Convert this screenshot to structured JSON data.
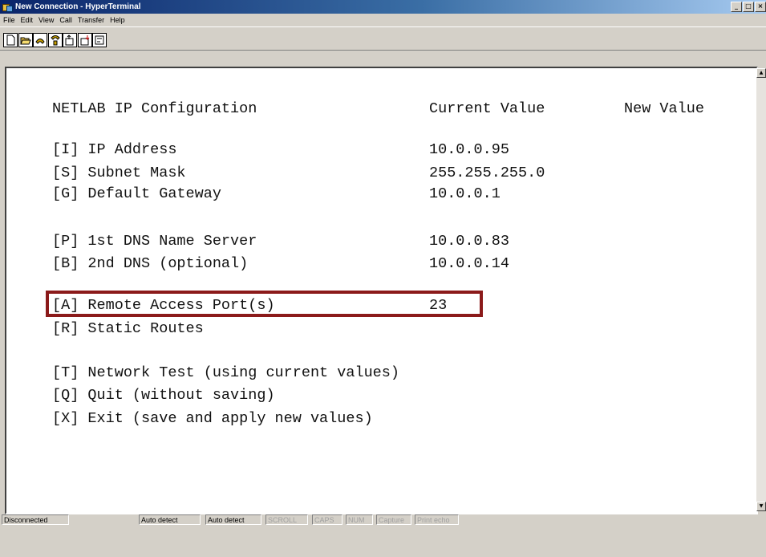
{
  "window": {
    "title": "New Connection - HyperTerminal",
    "buttons": {
      "minimize": "_",
      "maximize": "□",
      "close": "×"
    }
  },
  "menu": [
    "File",
    "Edit",
    "View",
    "Call",
    "Transfer",
    "Help"
  ],
  "toolbar": {
    "icons": [
      "new-icon",
      "open-icon",
      "call-icon",
      "disconnect-icon",
      "send-icon",
      "receive-icon",
      "properties-icon"
    ]
  },
  "terminal": {
    "header": {
      "title": "NETLAB IP Configuration",
      "current_col": "Current Value",
      "new_col": "New Value"
    },
    "items": [
      {
        "key": "[I] IP Address",
        "value": "10.0.0.95"
      },
      {
        "key": "[S] Subnet Mask",
        "value": "255.255.255.0"
      },
      {
        "key": "[G] Default Gateway",
        "value": "10.0.0.1"
      },
      {
        "key": "[P] 1st DNS Name Server",
        "value": "10.0.0.83"
      },
      {
        "key": "[B] 2nd DNS (optional)",
        "value": "10.0.0.14"
      },
      {
        "key": "[A] Remote Access Port(s)",
        "value": "23"
      },
      {
        "key": "[R] Static Routes",
        "value": ""
      },
      {
        "key": "[T] Network Test (using current values)",
        "value": ""
      },
      {
        "key": "[Q] Quit (without saving)",
        "value": ""
      },
      {
        "key": "[X] Exit (save and apply new values)",
        "value": ""
      }
    ]
  },
  "status": {
    "connection": "Disconnected",
    "detect1": "Auto detect",
    "detect2": "Auto detect",
    "scroll": "SCROLL",
    "caps": "CAPS",
    "num": "NUM",
    "capture": "Capture",
    "print": "Print echo"
  },
  "colors": {
    "highlight": "#8b1a1a",
    "titlebar_start": "#0a246a"
  }
}
